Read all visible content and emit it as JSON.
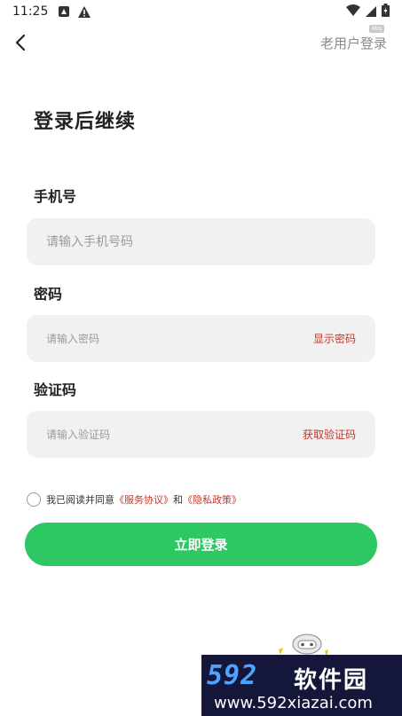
{
  "status_bar": {
    "time": "11:25",
    "icons": [
      "app-notification-icon",
      "warning-icon",
      "wifi-icon",
      "signal-icon",
      "battery-icon"
    ]
  },
  "header": {
    "back_icon": "chevron-left-icon",
    "old_user_login": "老用户登录",
    "corner_tag": "4bq"
  },
  "title": "登录后继续",
  "fields": {
    "phone": {
      "label": "手机号",
      "placeholder": "请输入手机号码"
    },
    "password": {
      "label": "密码",
      "placeholder": "请输入密码",
      "action": "显示密码"
    },
    "code": {
      "label": "验证码",
      "placeholder": "请输入验证码",
      "action": "获取验证码"
    }
  },
  "agreement": {
    "prefix": "我已阅读并同意",
    "service": "《服务协议》",
    "and": "和",
    "privacy": "《隐私政策》",
    "checked": false
  },
  "login_button": "立即登录",
  "watermark": {
    "number": "592",
    "name": "软件园",
    "url": "www.592xiazai.com"
  },
  "colors": {
    "accent_green": "#2dc864",
    "link_red": "#c0392b",
    "field_bg": "#f1f1f1",
    "watermark_bg": "#14163a",
    "watermark_number": "#4da3ff"
  }
}
